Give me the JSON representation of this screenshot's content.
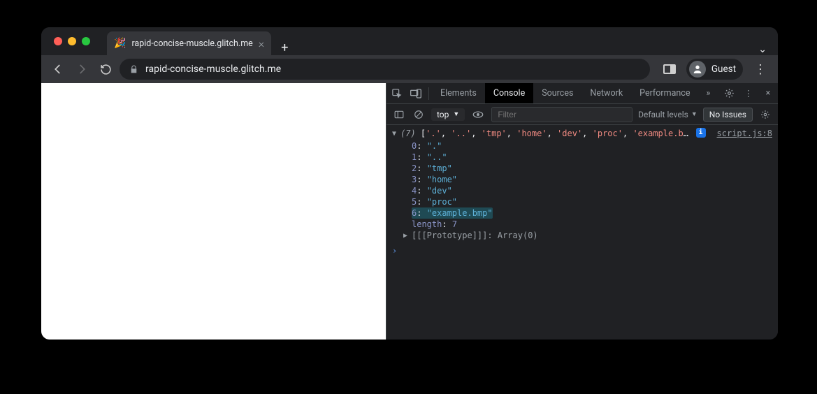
{
  "tab": {
    "title": "rapid-concise-muscle.glitch.me",
    "favicon": "🎉"
  },
  "toolbar": {
    "url": "rapid-concise-muscle.glitch.me",
    "profile": "Guest"
  },
  "devtools": {
    "tabs": {
      "elements": "Elements",
      "console": "Console",
      "sources": "Sources",
      "network": "Network",
      "performance": "Performance"
    },
    "sub": {
      "context": "top",
      "filter_placeholder": "Filter",
      "levels": "Default levels",
      "issues": "No Issues"
    },
    "source_link": "script.js:8"
  },
  "console": {
    "count": 7,
    "items": [
      ".",
      "..",
      "tmp",
      "home",
      "dev",
      "proc",
      "example.bmp"
    ],
    "length_label": "length",
    "length_value": "7",
    "prototype_label": "[[Prototype]]",
    "prototype_value": "Array(0)",
    "highlight_index": 6
  }
}
